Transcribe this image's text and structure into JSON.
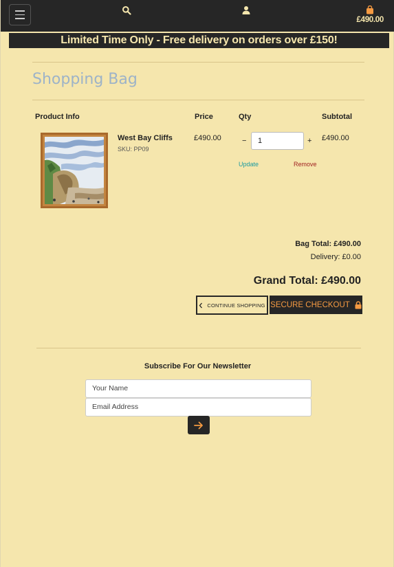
{
  "header": {
    "bag_total": "£490.00",
    "icons": [
      "menu-icon",
      "search-icon",
      "user-icon",
      "shopping-bag-icon"
    ]
  },
  "banner": {
    "text": "Limited Time Only - Free delivery on orders over £150!"
  },
  "page": {
    "title": "Shopping Bag"
  },
  "table": {
    "headers": [
      "Product Info",
      "Price",
      "Qty",
      "Subtotal"
    ],
    "rows": [
      {
        "name": "West Bay Cliffs",
        "sku": "SKU: PP09",
        "price": "£490.00",
        "qty": "1",
        "subtotal": "£490.00",
        "update_label": "Update",
        "remove_label": "Remove"
      }
    ],
    "qty_minus": "−",
    "qty_plus": "+"
  },
  "totals": {
    "bag_total": "Bag Total: £490.00",
    "delivery": "Delivery: £0.00",
    "grand_total": "Grand Total: £490.00"
  },
  "actions": {
    "continue_label": "CONTINUE SHOPPING",
    "checkout_label": "SECURE CHECKOUT"
  },
  "newsletter": {
    "title": "Subscribe For Our Newsletter",
    "name_placeholder": "Your Name",
    "email_placeholder": "Email Address"
  },
  "colors": {
    "background": "#f5e6ad",
    "dark": "#262626",
    "accent_orange": "#f59a42",
    "title_blue": "#9db3c8",
    "update_teal": "#1a9aa0",
    "remove_red": "#a02020"
  }
}
